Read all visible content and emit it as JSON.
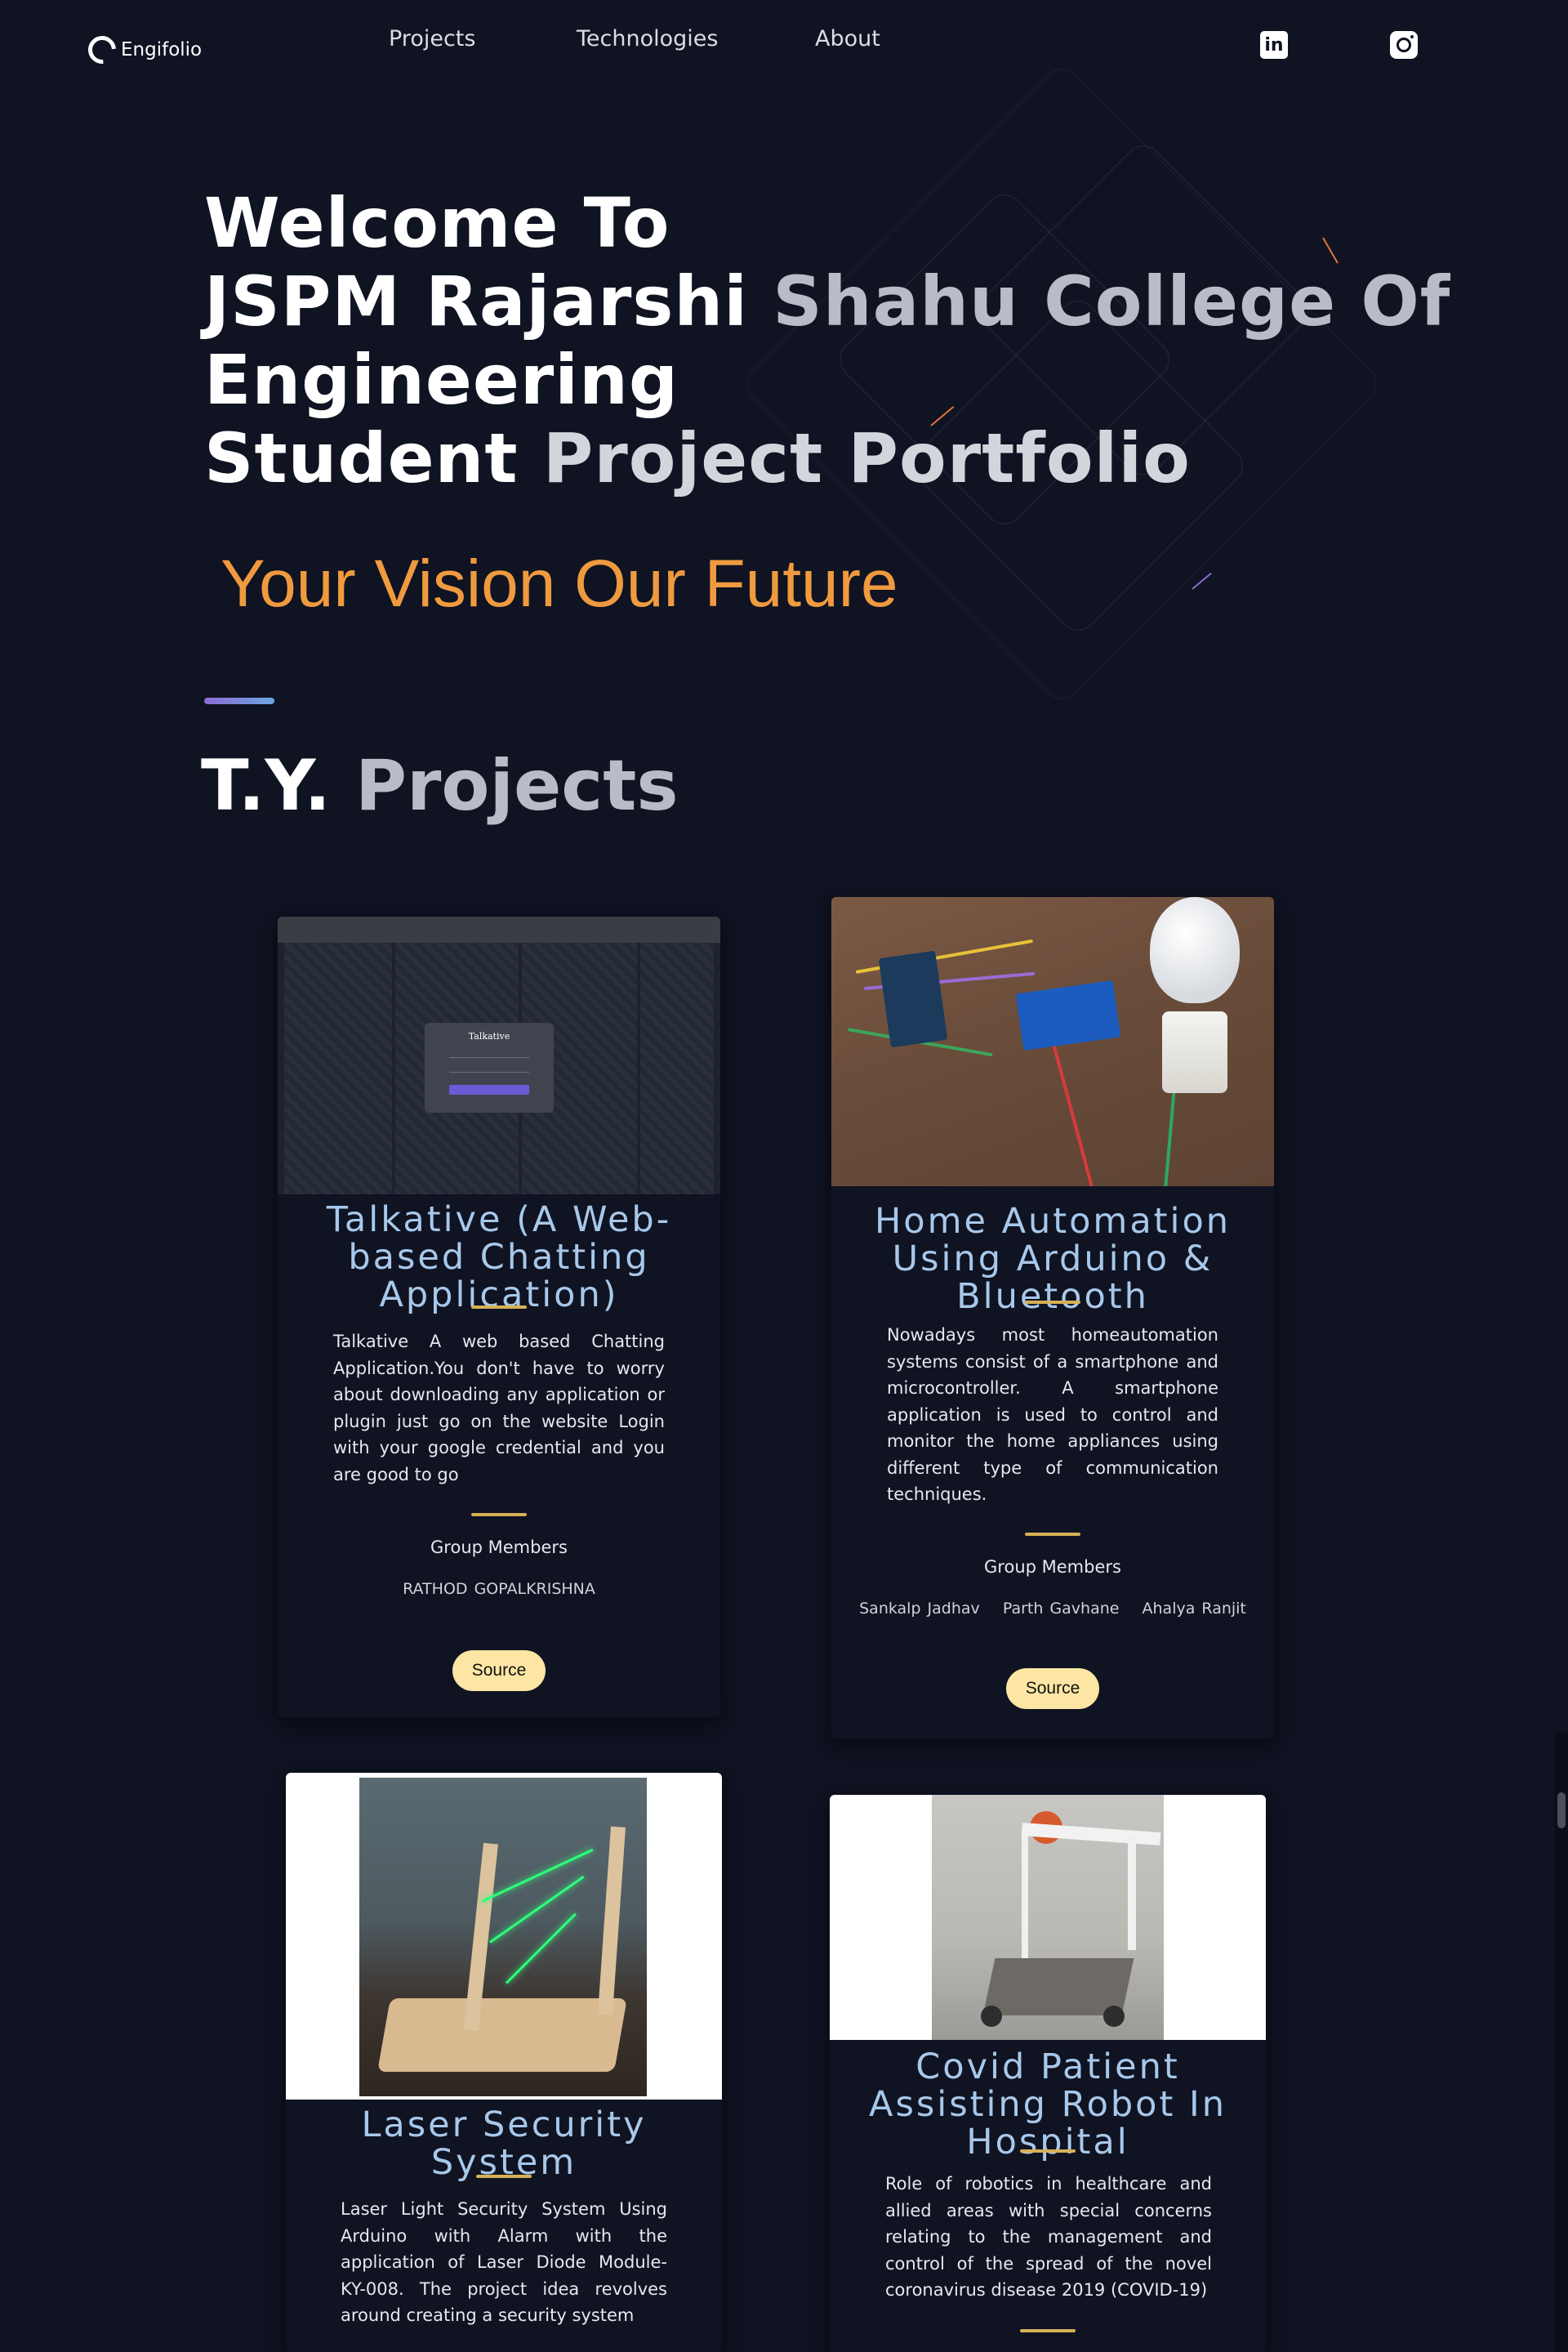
{
  "nav": {
    "brand": "Engifolio",
    "links": [
      "Projects",
      "Technologies",
      "About"
    ],
    "linkedin_label": "in"
  },
  "hero": {
    "line1": "Welcome To",
    "line2a": "JSPM Rajarshi ",
    "line2b": "Shahu College Of",
    "line3": "Engineering",
    "line4a": "Student ",
    "line4b": "Project Portfolio",
    "tagline": "Your Vision Our Future"
  },
  "section": {
    "title_a": "T.Y.",
    "title_b": "Projects"
  },
  "colors": {
    "background": "#0f1322",
    "accent_orange": "#ef9a3f",
    "card_title": "#a8c8ea",
    "gold_divider": "#d7b056",
    "source_button": "#fde6a4"
  },
  "projects": [
    {
      "title": "Talkative (A Web-based Chatting Application)",
      "description": "Talkative A web based Chatting Application.You don't have to worry about downloading any application or plugin just go on the website Login with your google credential and you are good to go",
      "group_label": "Group Members",
      "members": [
        "RATHOD GOPALKRISHNA"
      ],
      "button": "Source",
      "screenshot_title": "Talkative"
    },
    {
      "title": "Home Automation Using Arduino & Bluetooth",
      "description": "Nowadays most homeautomation systems consist of a smartphone and microcontroller. A smartphone application is used to control and monitor the home appliances using different type of communication techniques.",
      "group_label": "Group Members",
      "members": [
        "Sankalp Jadhav",
        "Parth Gavhane",
        "Ahalya Ranjit"
      ],
      "button": "Source"
    },
    {
      "title": "Laser Security System",
      "description": "Laser Light Security System Using Arduino with Alarm with the application of Laser Diode Module- KY-008. The project idea revolves around creating a security system"
    },
    {
      "title": "Covid Patient Assisting Robot In Hospital",
      "description": "Role of robotics in healthcare and allied areas with special concerns relating to the management and control of the spread of the novel coronavirus disease 2019 (COVID-19)"
    }
  ]
}
